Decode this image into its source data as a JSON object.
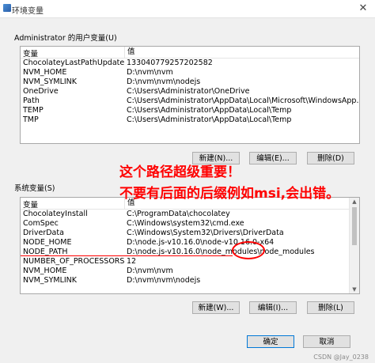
{
  "window": {
    "title": "环境变量",
    "close_glyph": "✕"
  },
  "user_group": {
    "label": "Administrator 的用户变量(U)",
    "columns": [
      "变量",
      "值"
    ],
    "rows": [
      [
        "ChocolateyLastPathUpdate",
        "133040779257202582"
      ],
      [
        "NVM_HOME",
        "D:\\nvm\\nvm"
      ],
      [
        "NVM_SYMLINK",
        "D:\\nvm\\nvm\\nodejs"
      ],
      [
        "OneDrive",
        "C:\\Users\\Administrator\\OneDrive"
      ],
      [
        "Path",
        "C:\\Users\\Administrator\\AppData\\Local\\Microsoft\\WindowsApp..."
      ],
      [
        "TEMP",
        "C:\\Users\\Administrator\\AppData\\Local\\Temp"
      ],
      [
        "TMP",
        "C:\\Users\\Administrator\\AppData\\Local\\Temp"
      ]
    ],
    "buttons": {
      "new": "新建(N)...",
      "edit": "编辑(E)...",
      "delete": "删除(D)"
    }
  },
  "sys_group": {
    "label": "系统变量(S)",
    "columns": [
      "变量",
      "值"
    ],
    "rows": [
      [
        "ChocolateyInstall",
        "C:\\ProgramData\\chocolatey"
      ],
      [
        "ComSpec",
        "C:\\Windows\\system32\\cmd.exe"
      ],
      [
        "DriverData",
        "C:\\Windows\\System32\\Drivers\\DriverData"
      ],
      [
        "NODE_HOME",
        "D:\\node.js-v10.16.0\\node-v10.16.0-x64"
      ],
      [
        "NODE_PATH",
        "D:\\node.js-v10.16.0\\node_modules\\node_modules"
      ],
      [
        "NUMBER_OF_PROCESSORS",
        "12"
      ],
      [
        "NVM_HOME",
        "D:\\nvm\\nvm"
      ],
      [
        "NVM_SYMLINK",
        "D:\\nvm\\nvm\\nodejs"
      ]
    ],
    "buttons": {
      "new": "新建(W)...",
      "edit": "编辑(I)...",
      "delete": "删除(L)"
    }
  },
  "footer": {
    "ok": "确定",
    "cancel": "取消"
  },
  "annotation": {
    "line1": "这个路径超级重要！",
    "line2": "不要有后面的后缀例如msi,会出错。",
    "color": "#ff0000"
  },
  "watermark": "CSDN @Jay_0238"
}
